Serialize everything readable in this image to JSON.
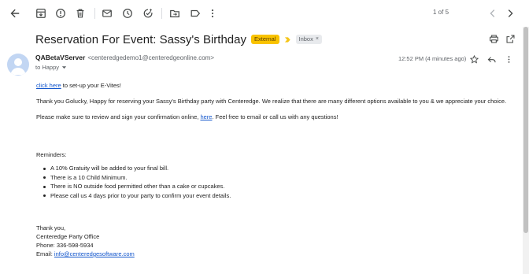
{
  "toolbar": {
    "icons": [
      "back-arrow-icon",
      "archive-icon",
      "report-spam-icon",
      "delete-icon",
      "mark-unread-icon",
      "snooze-icon",
      "add-to-tasks-icon",
      "move-to-icon",
      "labels-icon",
      "more-vert-icon"
    ],
    "pager_text": "1 of 5"
  },
  "subject": {
    "title": "Reservation For Event: Sassy's Birthday",
    "label_external": "External",
    "label_inbox": "Inbox",
    "label_inbox_remove": "×"
  },
  "sender": {
    "name": "QABetaVServer",
    "email": "<centeredgedemo1@centeredgeonline.com>",
    "to": "to Happy",
    "time": "12:52 PM (4 minutes ago)"
  },
  "body": {
    "link1_text": "click here",
    "line1_rest": " to set-up your E-Vites!",
    "line2": "Thank you Golucky, Happy for reserving your Sassy's Birthday party with Centeredge.  We realize that there are many different options available to you & we appreciate your choice.",
    "line3_pre": "Please make sure to review and sign your confirmation online, ",
    "line3_link": "here",
    "line3_post": ".  Feel free to email or call us with any questions!",
    "reminders_heading": "Reminders:",
    "reminders": [
      "A 10% Gratuity will be added to your final bill.",
      "There is a 10 Child Minimum.",
      "There is NO outside food permitted other than a cake or cupcakes.",
      "Please call us 4 days prior to your party to confirm your event details."
    ],
    "signoff": "Thank you,",
    "office": "Centeredge Party Office",
    "phone": "Phone: 336-598-5934",
    "email_label": "Email: ",
    "email_link": "info@centeredgesoftware.com"
  },
  "colors": {
    "external_label": "#f9c300",
    "link": "#1155cc",
    "avatar": "#c2d6f3"
  }
}
